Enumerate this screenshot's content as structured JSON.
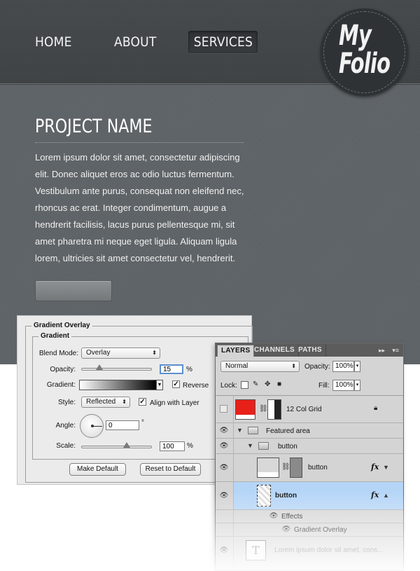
{
  "site": {
    "nav": {
      "home": "HOME",
      "about": "ABOUT",
      "services": "SERVICES"
    },
    "logo": {
      "line1": "My",
      "line2": "Folio"
    },
    "project_title": "PROJECT NAME",
    "body_text": "Lorem ipsum dolor sit amet, consectetur adipiscing elit. Donec aliquet eros ac odio luctus fermentum. Vestibulum ante purus, consequat non eleifend nec, rhoncus ac erat. Integer condimentum, augue a hendrerit facilisis, lacus purus pellentesque mi, sit amet pharetra mi neque eget ligula. Aliquam ligula lorem, ultricies sit amet consectetur vel, hendrerit."
  },
  "gradient_overlay": {
    "title": "Gradient Overlay",
    "group_title": "Gradient",
    "blend_mode_label": "Blend Mode:",
    "blend_mode": "Overlay",
    "opacity_label": "Opacity:",
    "opacity_value": "15",
    "opacity_unit": "%",
    "opacity_level": 0.15,
    "gradient_label": "Gradient:",
    "reverse_label": "Reverse",
    "reverse_checked": true,
    "style_label": "Style:",
    "style_value": "Reflected",
    "align_label": "Align with Layer",
    "align_checked": true,
    "angle_label": "Angle:",
    "angle_value": "0",
    "angle_unit": "°",
    "scale_label": "Scale:",
    "scale_value": "100",
    "scale_unit": "%",
    "scale_level": 1.0,
    "make_default": "Make Default",
    "reset_default": "Reset to Default"
  },
  "layers_panel": {
    "tabs": [
      "LAYERS",
      "CHANNELS",
      "PATHS"
    ],
    "blend_mode": "Normal",
    "opacity_label": "Opacity:",
    "opacity_value": "100%",
    "lock_label": "Lock:",
    "fill_label": "Fill:",
    "fill_value": "100%",
    "layers": {
      "grid": "12 Col Grid",
      "featured": "Featured area",
      "button_group": "button",
      "button_shape": "button",
      "button_selected": "button",
      "effects": "Effects",
      "gradient_overlay": "Gradient Overlay",
      "text_layer": "Lorem ipsum dolor sit amet, cons..."
    },
    "fx_label": "fx",
    "text_thumb": "T"
  },
  "colors": {
    "grid_swatch": "#e8201a",
    "selected_row": "#b5d5f7"
  }
}
